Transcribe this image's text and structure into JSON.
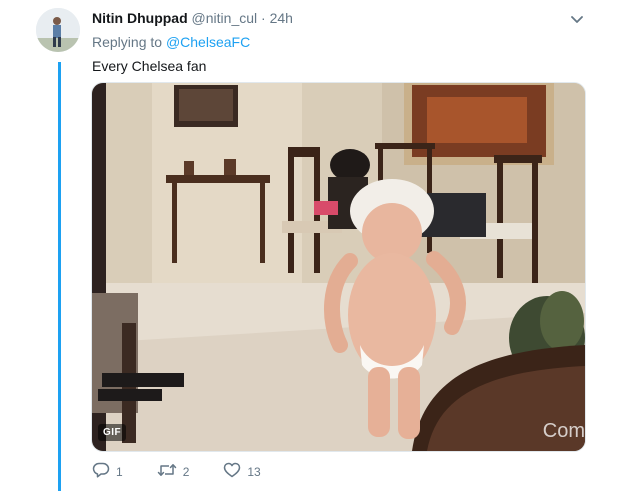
{
  "tweet": {
    "author_name": "Nitin Dhuppad",
    "author_handle": "@nitin_cul",
    "separator": "·",
    "time": "24h",
    "reply_prefix": "Replying to",
    "reply_mention": "@ChelseaFC",
    "text": "Every Chelsea fan",
    "media": {
      "badge": "GIF",
      "watermark": "Com"
    },
    "actions": {
      "reply_count": "1",
      "retweet_count": "2",
      "like_count": "13"
    }
  },
  "icons": {
    "caret": "chevron-down-icon",
    "reply": "reply-icon",
    "retweet": "retweet-icon",
    "like": "heart-icon"
  },
  "colors": {
    "accent": "#1da1f2",
    "secondary_text": "#657786",
    "primary_text": "#14171a"
  }
}
